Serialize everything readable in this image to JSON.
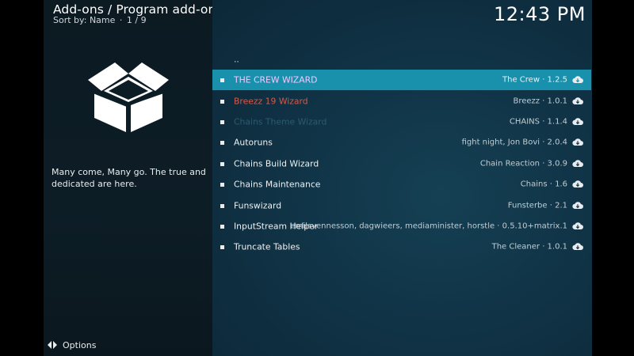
{
  "header": {
    "title": "Add-ons / Program add-ons",
    "sort_label": "Sort by: Name",
    "separator": "·",
    "page": "1 / 9"
  },
  "clock": "12:43 PM",
  "info_panel": {
    "icon": "open-box-icon",
    "description": "Many come, Many go. The true and dedicated are here."
  },
  "footer": {
    "options_icon": "options-arrows-icon",
    "options_label": "Options"
  },
  "list": {
    "parent_label": "..",
    "items": [
      {
        "name": "THE CREW WIZARD",
        "meta": "The Crew · 1.2.5",
        "selected": true,
        "name_color": "#f7c7ff"
      },
      {
        "name": "Breezz 19 Wizard",
        "meta": "Breezz · 1.0.1",
        "name_color": "#d35a4a"
      },
      {
        "name": "Chains Theme Wizard",
        "meta": "CHAINS · 1.1.4",
        "name_color": "#2d5a6e"
      },
      {
        "name": "Autoruns",
        "meta": "fight night, Jon Bovi · 2.0.4"
      },
      {
        "name": "Chains Build Wizard",
        "meta": "Chain Reaction · 3.0.9"
      },
      {
        "name": "Chains Maintenance",
        "meta": "Chains · 1.6"
      },
      {
        "name": "Funswizard",
        "meta": "Funsterbe · 2.1"
      },
      {
        "name": "InputStream Helper",
        "meta": "emilsvennesson, dagwieers, mediaminister, horstle · 0.5.10+matrix.1"
      },
      {
        "name": "Truncate Tables",
        "meta": "The Cleaner · 1.0.1"
      }
    ],
    "item_icon": "cloud-download-icon"
  },
  "colors": {
    "selection": "#1991ad",
    "background": "#0e2d3c"
  }
}
